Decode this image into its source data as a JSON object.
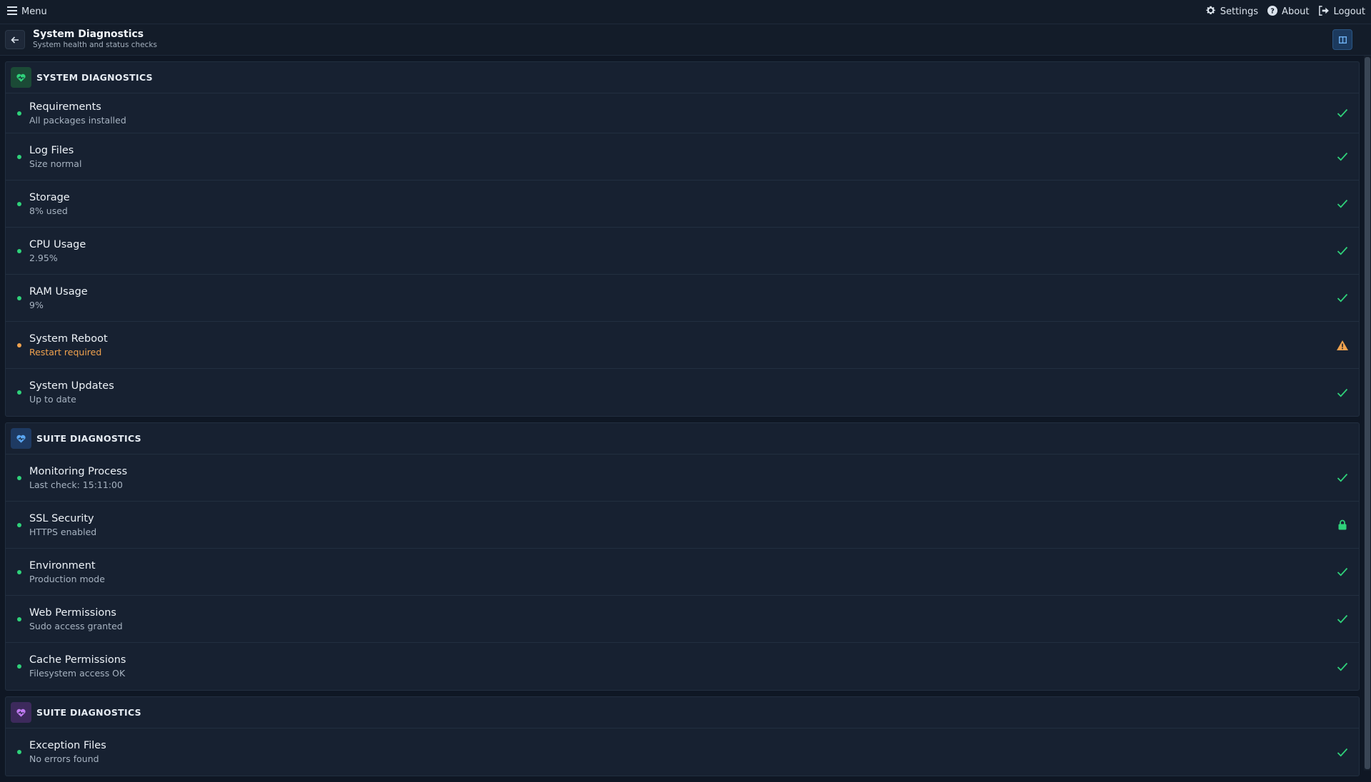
{
  "topbar": {
    "menu_label": "Menu",
    "settings_label": "Settings",
    "about_label": "About",
    "logout_label": "Logout"
  },
  "header": {
    "title": "System Diagnostics",
    "subtitle": "System health and status checks"
  },
  "colors": {
    "ok": "#2fd27a",
    "warning": "#f0a24e",
    "section1_icon_bg": "#1b4a36",
    "section2_icon_bg": "#1e3a62",
    "section3_icon_bg": "#3d2a5c"
  },
  "sections": [
    {
      "title": "SYSTEM DIAGNOSTICS",
      "icon": "heart-pulse-icon",
      "items": [
        {
          "name": "Requirements",
          "status": "All packages installed",
          "state": "ok",
          "indicator": "check-icon"
        },
        {
          "name": "Log Files",
          "status": "Size normal",
          "state": "ok",
          "indicator": "check-icon"
        },
        {
          "name": "Storage",
          "status": "8% used",
          "state": "ok",
          "indicator": "check-icon"
        },
        {
          "name": "CPU Usage",
          "status": "2.95%",
          "state": "ok",
          "indicator": "check-icon"
        },
        {
          "name": "RAM Usage",
          "status": "9%",
          "state": "ok",
          "indicator": "check-icon"
        },
        {
          "name": "System Reboot",
          "status": "Restart required",
          "state": "warning",
          "indicator": "warning-icon"
        },
        {
          "name": "System Updates",
          "status": "Up to date",
          "state": "ok",
          "indicator": "check-icon"
        }
      ]
    },
    {
      "title": "SUITE DIAGNOSTICS",
      "icon": "heart-pulse-icon",
      "items": [
        {
          "name": "Monitoring Process",
          "status": "Last check: 15:11:00",
          "state": "ok",
          "indicator": "check-icon"
        },
        {
          "name": "SSL Security",
          "status": "HTTPS enabled",
          "state": "ok",
          "indicator": "lock-icon"
        },
        {
          "name": "Environment",
          "status": "Production mode",
          "state": "ok",
          "indicator": "check-icon"
        },
        {
          "name": "Web Permissions",
          "status": "Sudo access granted",
          "state": "ok",
          "indicator": "check-icon"
        },
        {
          "name": "Cache Permissions",
          "status": "Filesystem access OK",
          "state": "ok",
          "indicator": "check-icon"
        }
      ]
    },
    {
      "title": "SUITE DIAGNOSTICS",
      "icon": "heart-pulse-icon",
      "items": [
        {
          "name": "Exception Files",
          "status": "No errors found",
          "state": "ok",
          "indicator": "check-icon"
        }
      ]
    }
  ]
}
